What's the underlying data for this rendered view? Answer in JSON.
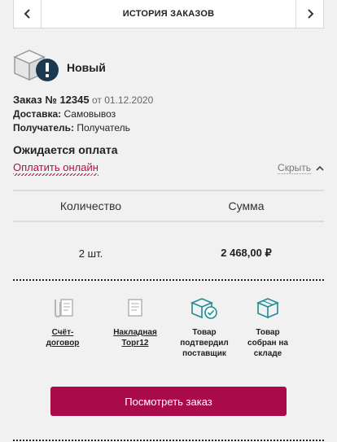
{
  "header": {
    "title": "ИСТОРИЯ ЗАКАЗОВ",
    "prev_icon": "chevron-left-icon",
    "next_icon": "chevron-right-icon"
  },
  "status": {
    "label": "Новый",
    "icon": "box-alert-icon"
  },
  "order": {
    "number": "Заказ № 12345",
    "date": "от 01.12.2020",
    "delivery_label": "Доставка:",
    "delivery_value": "Самовывоз",
    "recipient_label": "Получатель:",
    "recipient_value": "Получатель"
  },
  "payment": {
    "title": "Ожидается оплата",
    "pay_link": "Оплатить онлайн",
    "hide_label": "Скрыть"
  },
  "table": {
    "headers": [
      "Количество",
      "Сумма"
    ],
    "quantity": "2 шт.",
    "sum": "2 468,00 ₽"
  },
  "documents": [
    {
      "line1": "Счёт-",
      "line2": "договор",
      "line3": "",
      "icon": "paperclip-document-icon"
    },
    {
      "line1": "Накладная",
      "line2": "Торг12",
      "line3": "",
      "icon": "document-icon"
    },
    {
      "line1": "Товар",
      "line2": "подтвердил",
      "line3": "поставщик",
      "icon": "box-check-icon"
    },
    {
      "line1": "Товар",
      "line2": "собран на",
      "line3": "складе",
      "icon": "box-icon"
    }
  ],
  "actions": {
    "view_order": "Посмотреть заказ"
  },
  "colors": {
    "accent": "#a90a4a",
    "link": "#b0104c",
    "teal": "#1f8d93",
    "alert": "#1b3a52"
  }
}
